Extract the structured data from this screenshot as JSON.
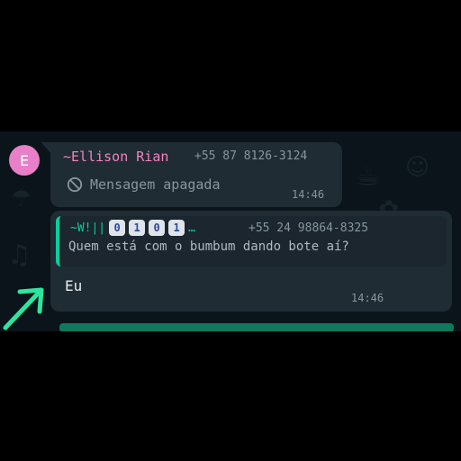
{
  "deleted_message": {
    "avatar_letter": "E",
    "sender_name": "~Ellison Rian",
    "sender_phone": "+55 87 8126-3124",
    "text": "Mensagem apagada",
    "time": "14:46"
  },
  "reply_message": {
    "quoted": {
      "sender_name": "~W!||",
      "sender_keys": [
        "0",
        "1",
        "0",
        "1"
      ],
      "ellipsis": "…",
      "sender_phone": "+55 24 98864-8325",
      "text": "Quem está com o bumbum dando bote aí?"
    },
    "text": "Eu",
    "time": "14:46"
  },
  "colors": {
    "chat_background": "#0b141a",
    "bubble": "#202c33",
    "accent_green": "#06cf9c",
    "sender_pink": "#ef83c3",
    "avatar_pink": "#e87fc8"
  },
  "icons": [
    "blocked-icon",
    "arrow-annotation"
  ]
}
